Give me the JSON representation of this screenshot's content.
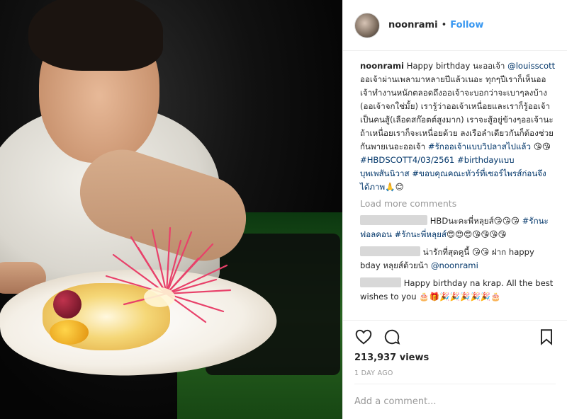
{
  "post": {
    "username": "noonrami",
    "separator": "•",
    "follow_label": "Follow",
    "caption": {
      "username": "noonrami",
      "line1": " Happy birthday นะออเจ้า ",
      "mention": "@louisscott",
      "body": " ออเจ้าผ่านเพลามาหลายปีแล้วเนอะ ทุกๆปีเราก็เห็นออเจ้าทำงานหนักตลอดถึงออเจ้าจะบอกว่าจะเบาๆลงบ้าง (ออเจ้าจกใช่มั้ย) เรารู้ว่าออเจ้าเหนื่อยและเราก็รู้ออเจ้าเป็นคนสู้(เลือดสก๊อตต์สูงมาก) เราจะสู้อยู่ข้างๆออเจ้านะ ถ้าเหนื่อยเราก็จะเหนื่อยด้วย ลงเรือลำเดียวกันก็ต้องช่วยกันพายเนอะออเจ้า ",
      "tag1": "#รักออเจ้าแบบวิปลาสไปแล้ว",
      "emoji1": " 😘😘",
      "tag2": "#HBDSCOTT4/03/2561",
      "tag3": "#birthdayแบบบุพเพสันนิวาส",
      "tag4": "#ขอบคุณคณะทัวร์ที่เซอร์ไพรส์ก่อนจึงได้ภาพ",
      "emoji2": "🙏😊"
    },
    "load_more": "Load more comments",
    "comments": [
      {
        "text": "HBDนะคะพี่หลุยส์😘😘😘",
        "tag": "#รักนะฟอลคอน #รักนะพี่หลุยส์",
        "emoji": "😍😍😍😘😘😘😘"
      },
      {
        "text": "น่ารักที่สุดคูนี้ 😘😘 ฝาก happy bday หลุยส์ด้วยน้า ",
        "mention": "@noonrami"
      },
      {
        "text": "Happy birthday na krap. All the best wishes to you 🎂🎁🎉🎉🎉🎉🎉🎂"
      }
    ],
    "views": "213,937 views",
    "date": "1 DAY AGO",
    "add_comment_placeholder": "Add a comment..."
  },
  "colors": {
    "link": "#003569",
    "follow": "#3897f0",
    "muted": "#999999"
  },
  "icons": [
    "heart-icon",
    "comment-bubble-icon",
    "bookmark-icon"
  ]
}
